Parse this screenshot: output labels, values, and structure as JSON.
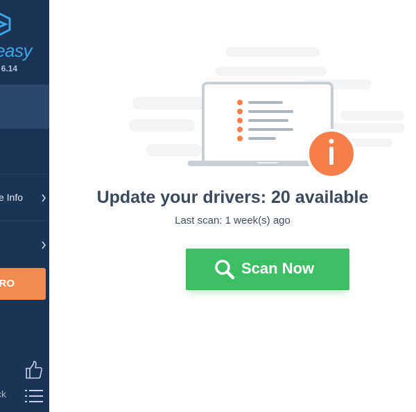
{
  "app": {
    "logo_text": "easy",
    "version": "6.14",
    "colors": {
      "sidebar": "#1b3357",
      "accent": "#3da6e8",
      "pro": "#f68b52",
      "scan": "#3cbf62",
      "info": "#f57f4b"
    }
  },
  "sidebar": {
    "items": [
      {
        "label": "",
        "icon": "scan-icon",
        "active": true
      },
      {
        "label": "",
        "icon": ""
      },
      {
        "label": "e Info",
        "icon": "chevron-right-icon"
      },
      {
        "label": "",
        "icon": "chevron-right-icon"
      }
    ],
    "pro_label": "RO",
    "feedback_label": "ck",
    "bottom_icons": [
      "thumbs-up-icon",
      "menu-icon"
    ]
  },
  "main": {
    "illustration_icon": "laptop-list-info-icon",
    "headline": "Update your drivers: 20 available",
    "last_scan": "Last scan: 1 week(s) ago",
    "scan_button_label": "Scan Now",
    "scan_button_icon": "magnifier-icon"
  }
}
